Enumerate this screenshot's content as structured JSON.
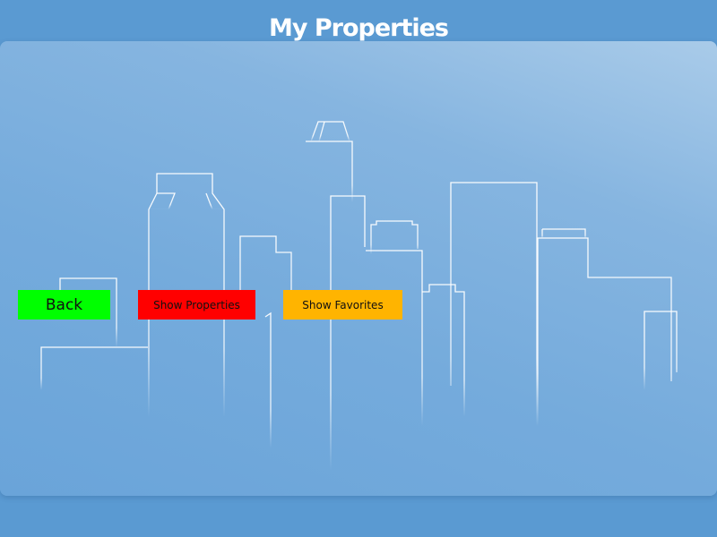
{
  "header": {
    "title": "My Properties"
  },
  "toolbar": {
    "back_label": "Back",
    "show_properties_label": "Show Properties",
    "show_favorites_label": "Show Favorites"
  },
  "colors": {
    "background": "#5a9ad2",
    "title_text": "#ffffff",
    "back_button": "#00ff00",
    "show_properties_button": "#ff0000",
    "show_favorites_button": "#ffb400",
    "skyline_stroke": "#ffffff"
  },
  "background_art": {
    "icon": "city-skyline-illustration"
  }
}
